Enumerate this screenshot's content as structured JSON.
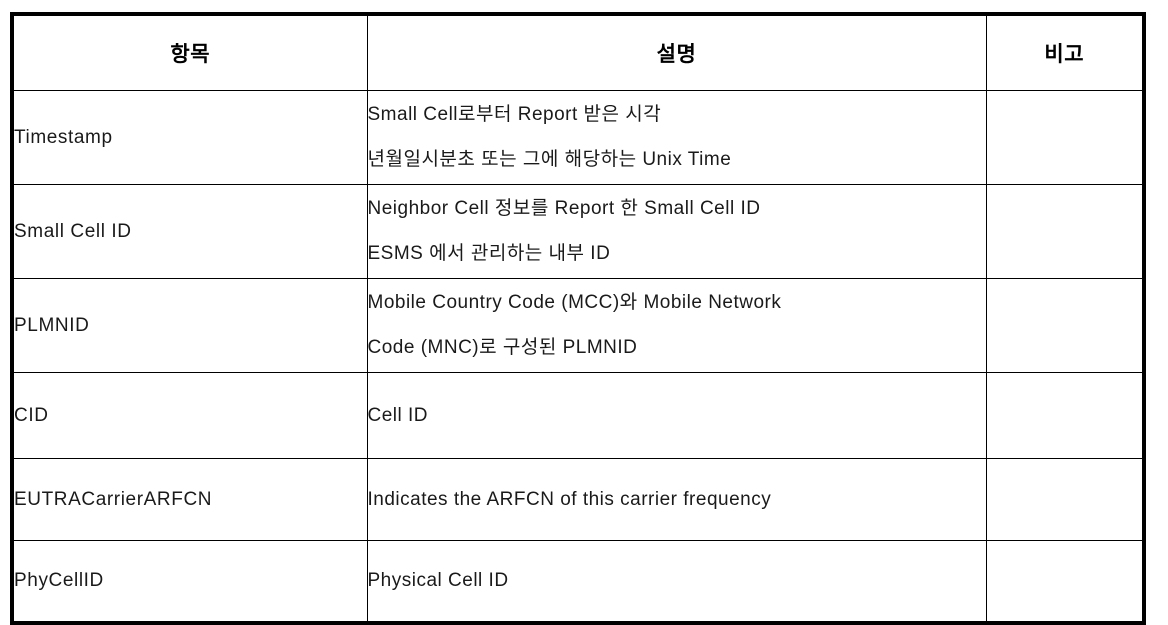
{
  "table": {
    "headers": [
      "항목",
      "설명",
      "비고"
    ],
    "rows": [
      {
        "item": "Timestamp",
        "description_lines": [
          "Small Cell로부터 Report 받은 시각",
          "년월일시분초 또는 그에 해당하는 Unix Time"
        ],
        "note": ""
      },
      {
        "item": "Small Cell ID",
        "description_lines": [
          "Neighbor Cell 정보를 Report 한 Small Cell ID",
          "ESMS 에서 관리하는 내부 ID"
        ],
        "note": ""
      },
      {
        "item": "PLMNID",
        "description_lines": [
          "Mobile Country Code (MCC)와 Mobile Network",
          "Code (MNC)로 구성된 PLMNID"
        ],
        "note": ""
      },
      {
        "item": "CID",
        "description_lines": [
          "Cell ID"
        ],
        "note": ""
      },
      {
        "item": "EUTRACarrierARFCN",
        "description_lines": [
          "Indicates the ARFCN of this carrier frequency"
        ],
        "note": ""
      },
      {
        "item": "PhyCellID",
        "description_lines": [
          "Physical Cell ID"
        ],
        "note": ""
      }
    ]
  },
  "colors": {
    "header_background": "#CCFFFF",
    "border": "#000000",
    "text": "#1A1A1A",
    "page_background": "#FFFFFF"
  }
}
